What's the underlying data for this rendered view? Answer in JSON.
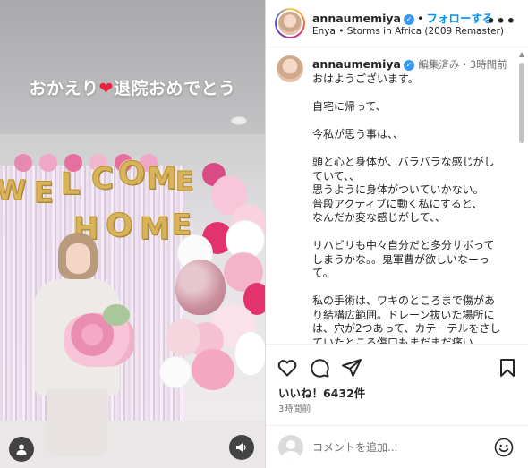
{
  "media": {
    "overlay_text_before": "おかえり",
    "overlay_heart": "❤",
    "overlay_text_after": "退院おめでとう",
    "balloon_letters_row1": [
      "W",
      "E",
      "L",
      "C",
      "O",
      "M",
      "E"
    ],
    "balloon_letters_row2": [
      "H",
      "O",
      "M",
      "E"
    ],
    "user_tag_icon": "user-icon",
    "sound_icon": "speaker-icon"
  },
  "header": {
    "username": "annaumemiya",
    "separator": "•",
    "follow_label": "フォローする",
    "music": "Enya • Storms in Africa (2009 Remaster)",
    "more_icon": "more-icon"
  },
  "caption": {
    "username": "annaumemiya",
    "edited": "編集済み",
    "separator": "・",
    "time": "3時間前",
    "lines": [
      "おはようございます。",
      "",
      "自宅に帰って、",
      "",
      "今私が思う事は、、",
      "",
      "頭と心と身体が、バラバラな感じがし",
      "ていて、、",
      "思うように身体がついていかない。",
      "普段アクティブに動く私にすると、",
      "なんだか変な感じがして、、",
      "",
      "リハビリも中々自分だと多分サボって",
      "しまうかな。。鬼軍曹が欲しいなーっ",
      "て。",
      "",
      "私の手術は、ワキのところまで傷があ",
      "り結構広範囲。ドレーン抜いた場所に",
      "は、穴が2つあって、カテーテルをさし",
      "ていたところ傷口もまだまだ痛い。"
    ]
  },
  "actions": {
    "likes": "いいね！6432件",
    "time": "3時間前"
  },
  "comment": {
    "placeholder": "コメントを追加...",
    "emoji_icon": "emoji-icon"
  },
  "colors": {
    "link_blue": "#0095f6",
    "verified_blue": "#3897f0",
    "heart_red": "#e8233d",
    "balloon_gold": "#d7b35c"
  }
}
